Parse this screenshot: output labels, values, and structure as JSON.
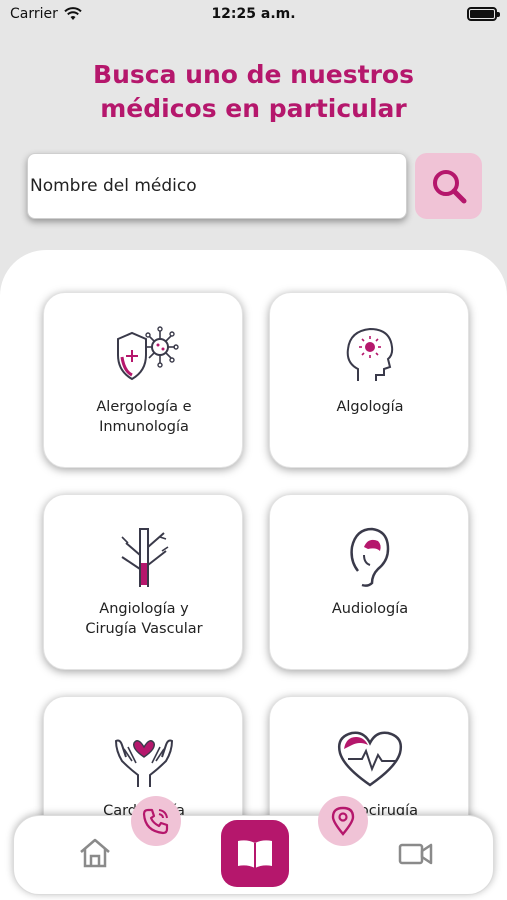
{
  "status_bar": {
    "carrier": "Carrier",
    "time": "12:25 a.m."
  },
  "header": {
    "title_line1": "Busca uno de nuestros",
    "title_line2": "médicos en particular"
  },
  "search": {
    "placeholder": "Nombre del médico",
    "value": ""
  },
  "specialties": [
    {
      "label": "Alergología e\nInmunología",
      "icon": "allergy-shield-icon"
    },
    {
      "label": "Algología",
      "icon": "head-pain-icon"
    },
    {
      "label": "Angiología y\nCirugía Vascular",
      "icon": "blood-vessel-icon"
    },
    {
      "label": "Audiología",
      "icon": "ear-icon"
    },
    {
      "label": "Cardiología",
      "icon": "hands-heart-icon"
    },
    {
      "label": "Cardiocirugía",
      "icon": "heart-pulse-icon"
    }
  ],
  "tab_bar": {
    "items": [
      {
        "name": "home",
        "icon": "home-icon"
      },
      {
        "name": "directory",
        "icon": "book-icon",
        "active": true
      },
      {
        "name": "video",
        "icon": "video-camera-icon"
      }
    ],
    "floating": [
      {
        "name": "call",
        "icon": "phone-icon"
      },
      {
        "name": "location",
        "icon": "location-pin-icon"
      }
    ]
  },
  "colors": {
    "accent": "#b5176c",
    "accent_light": "#f0c3d6",
    "background": "#e6e6e6",
    "icon_gray": "#3a3a4a",
    "inactive_gray": "#8a8a8a"
  }
}
